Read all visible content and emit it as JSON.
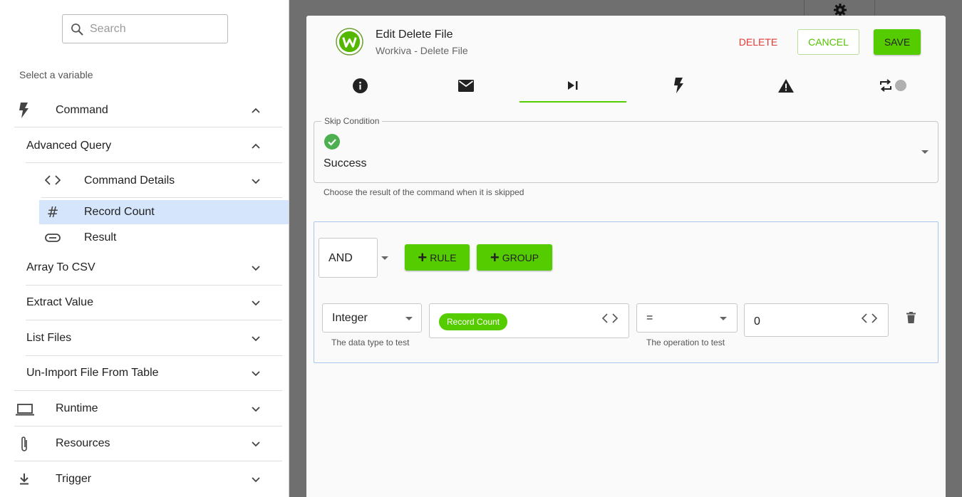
{
  "sidebar": {
    "search_placeholder": "Search",
    "select_variable_label": "Select a variable",
    "items": {
      "command": "Command",
      "advanced_query": "Advanced Query",
      "command_details": "Command Details",
      "record_count": "Record Count",
      "result": "Result",
      "array_to_csv": "Array To CSV",
      "extract_value": "Extract Value",
      "list_files": "List Files",
      "unimport": "Un-Import File From Table",
      "runtime": "Runtime",
      "resources": "Resources",
      "trigger": "Trigger"
    }
  },
  "dialog": {
    "title": "Edit Delete File",
    "subtitle": "Workiva - Delete File",
    "delete_label": "DELETE",
    "cancel_label": "CANCEL",
    "save_label": "SAVE",
    "tabs": [
      "info-icon",
      "mail-icon",
      "skip-next-icon",
      "bolt-icon",
      "warning-icon",
      "repeat-icon"
    ],
    "active_tab": 2,
    "skip": {
      "legend": "Skip Condition",
      "value": "Success",
      "helper": "Choose the result of the command when it is skipped"
    },
    "query": {
      "combinator": "AND",
      "rule_label": "RULE",
      "group_label": "GROUP",
      "rule": {
        "type": "Integer",
        "type_helper": "The data type to test",
        "variable_chip": "Record Count",
        "operator": "=",
        "operator_helper": "The operation to test",
        "value": "0"
      }
    }
  },
  "colors": {
    "accent_green": "#55cc00",
    "delete_red": "#e53935",
    "highlight_blue": "#d5e5fb"
  }
}
